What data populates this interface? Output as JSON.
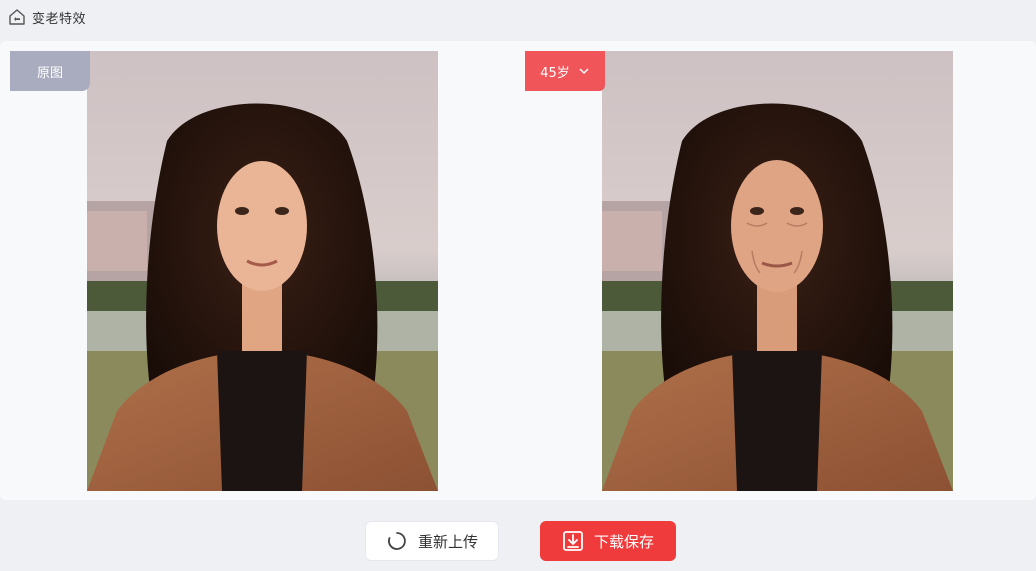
{
  "header": {
    "title": "变老特效",
    "icon": "home-icon"
  },
  "tags": {
    "original": "原图",
    "age_selected": "45岁"
  },
  "buttons": {
    "reupload": "重新上传",
    "save": "下载保存"
  },
  "colors": {
    "accent_red": "#f03b3d",
    "age_tag": "#f0555a",
    "original_tag": "#a9acbe"
  }
}
